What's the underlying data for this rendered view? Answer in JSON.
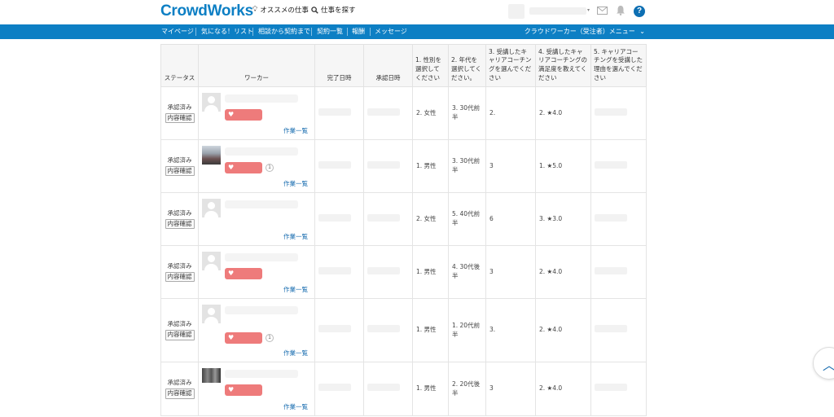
{
  "header": {
    "logo": "CrowdWorks",
    "recommend": "オススメの仕事",
    "search": "仕事を探す",
    "help": "?"
  },
  "nav": {
    "items": [
      "マイページ",
      "気になる！リスト",
      "相談から契約まで",
      "契約一覧",
      "報酬",
      "メッセージ"
    ],
    "menu": "クラウドワーカー（受注者）メニュー"
  },
  "table": {
    "headers": {
      "status": "ステータス",
      "worker": "ワーカー",
      "completed": "完了日時",
      "approved": "承認日時",
      "q1": "1. 性別を選択してください",
      "q2": "2. 年代を選択してください。",
      "q3": "3. 受講したキャリアコーチングを選んでください",
      "q4": "4. 受講したキャリアコーチングの満足度を教えてください",
      "q5": "5. キャリアコーチングを受講した理由を選んでください"
    },
    "rows": [
      {
        "status": "承認済み",
        "confirm": "内容確認",
        "works": "作業一覧",
        "q1": "2. 女性",
        "q2": "3. 30代前半",
        "q3": "2.",
        "q4": "2. ★4.0",
        "badge": ""
      },
      {
        "status": "承認済み",
        "confirm": "内容確認",
        "works": "作業一覧",
        "q1": "1. 男性",
        "q2": "3. 30代前半",
        "q3": "3",
        "q4": "1. ★5.0",
        "badge": "1"
      },
      {
        "status": "承認済み",
        "confirm": "内容確認",
        "works": "作業一覧",
        "q1": "2. 女性",
        "q2": "5. 40代前半",
        "q3": "6",
        "q4": "3. ★3.0",
        "badge": ""
      },
      {
        "status": "承認済み",
        "confirm": "内容確認",
        "works": "作業一覧",
        "q1": "1. 男性",
        "q2": "4. 30代後半",
        "q3": "3",
        "q4": "2. ★4.0",
        "badge": ""
      },
      {
        "status": "承認済み",
        "confirm": "内容確認",
        "works": "作業一覧",
        "q1": "1. 男性",
        "q2": "1. 20代前半",
        "q3": "3.",
        "q4": "2. ★4.0",
        "badge": "1"
      },
      {
        "status": "承認済み",
        "confirm": "内容確認",
        "works": "作業一覧",
        "q1": "1. 男性",
        "q2": "2. 20代後半",
        "q3": "3",
        "q4": "2. ★4.0",
        "badge": ""
      }
    ]
  },
  "colors": {
    "brand": "#0d7fc4",
    "heart_badge": "#ee7b7b",
    "link": "#1a6eb0"
  }
}
